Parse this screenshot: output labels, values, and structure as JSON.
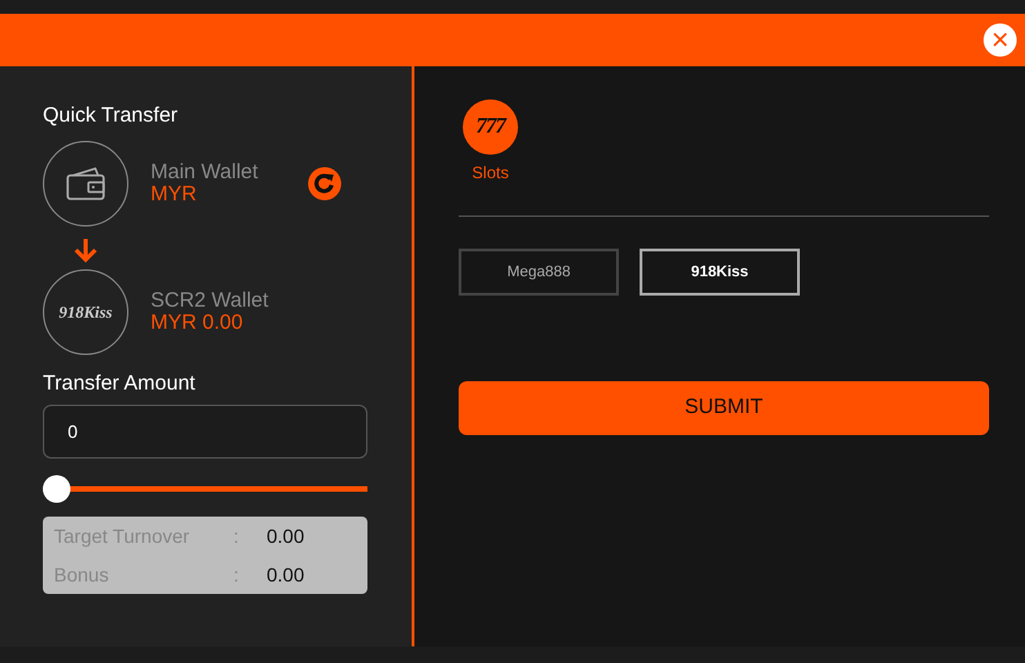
{
  "title_bar": {
    "close": "×"
  },
  "quick_transfer": {
    "title": "Quick Transfer",
    "from_wallet": {
      "name": "Main Wallet",
      "balance": "MYR"
    },
    "to_wallet": {
      "name": "SCR2 Wallet",
      "balance": "MYR 0.00",
      "logo": "918Kiss"
    }
  },
  "transfer_amount": {
    "label": "Transfer Amount",
    "value": "0",
    "slider": {
      "level": 0
    }
  },
  "summary": [
    {
      "label": "Target Turnover",
      "separator": ":",
      "value": "0.00"
    },
    {
      "label": "Bonus",
      "separator": ":",
      "value": "0.00"
    }
  ],
  "category": {
    "icon_text": "777",
    "label": "Slots"
  },
  "providers": [
    {
      "label": "Mega888",
      "selected": false
    },
    {
      "label": "918Kiss",
      "selected": true
    }
  ],
  "submit": "SUBMIT"
}
